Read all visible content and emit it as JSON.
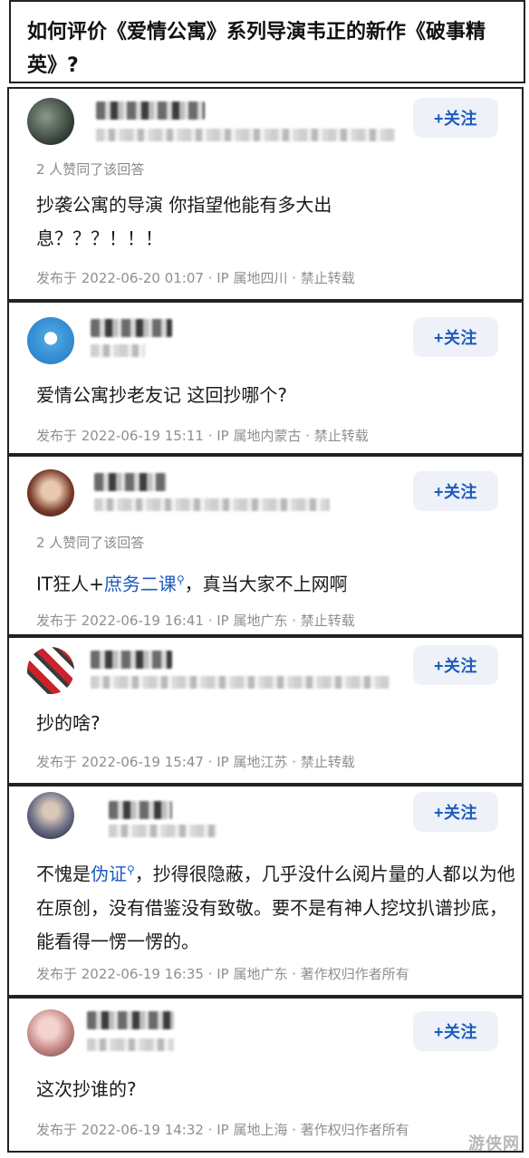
{
  "question": {
    "title": "如何评价《爱情公寓》系列导演韦正的新作《破事精英》?"
  },
  "follow_label": "+关注",
  "answers": [
    {
      "agree": "2 人赞同了该回答",
      "content": "抄袭公寓的导演 你指望他能有多大出息？？？！！！",
      "meta": "发布于 2022-06-20 01:07 · IP 属地四川 · 禁止转载"
    },
    {
      "agree": "",
      "content": "爱情公寓抄老友记 这回抄哪个?",
      "meta": "发布于 2022-06-19 15:11 · IP 属地内蒙古 · 禁止转载"
    },
    {
      "agree": "2 人赞同了该回答",
      "content_pre": "IT狂人+",
      "content_link": "庶务二课",
      "content_post": "，真当大家不上网啊",
      "meta": "发布于 2022-06-19 16:41 · IP 属地广东 · 禁止转载"
    },
    {
      "agree": "",
      "content": "抄的啥?",
      "meta": "发布于 2022-06-19 15:47 · IP 属地江苏 · 禁止转载"
    },
    {
      "agree": "",
      "content_pre": "不愧是",
      "content_link": "伪证",
      "content_post": "，抄得很隐蔽，几乎没什么阅片量的人都以为他在原创，没有借鉴没有致敬。要不是有神人挖坟扒谱抄底，能看得一愣一愣的。",
      "meta": "发布于 2022-06-19 16:35 · IP 属地广东 · 著作权归作者所有"
    },
    {
      "agree": "",
      "content": "这次抄谁的?",
      "meta": "发布于 2022-06-19 14:32 · IP 属地上海 · 著作权归作者所有"
    }
  ],
  "watermark": "游侠网",
  "colors": {
    "link": "#1d5bbf",
    "follow_bg": "#eef2f8",
    "meta": "#8f8f8f",
    "border": "#222222"
  },
  "icons": {
    "search_hint": "search-icon"
  }
}
